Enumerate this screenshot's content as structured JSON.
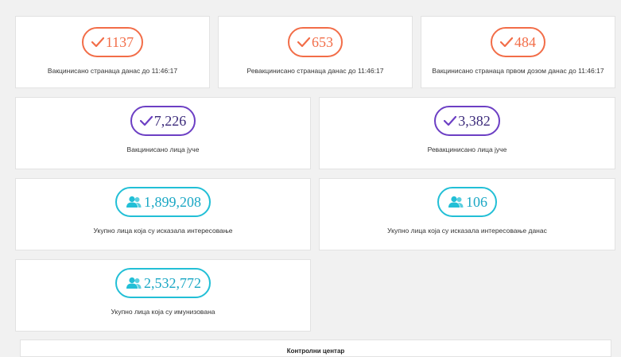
{
  "colors": {
    "orange": "#f26d48",
    "purple": "#6c3fc4",
    "teal": "#22bfd6",
    "background": "#f1f1f1"
  },
  "row1": [
    {
      "icon": "checkmark-icon",
      "value": "1137",
      "label": "Вакцинисано странаца данас до 11:46:17"
    },
    {
      "icon": "checkmark-icon",
      "value": "653",
      "label": "Ревакцинисано странаца данас до 11:46:17"
    },
    {
      "icon": "checkmark-icon",
      "value": "484",
      "label": "Вакцинисано странаца првом дозом данас до 11:46:17"
    }
  ],
  "row2": [
    {
      "icon": "checkmark-icon",
      "value": "7,226",
      "label": "Вакцинисано лица јуче"
    },
    {
      "icon": "checkmark-icon",
      "value": "3,382",
      "label": "Ревакцинисано лица јуче"
    }
  ],
  "row3": [
    {
      "icon": "people-icon",
      "value": "1,899,208",
      "label": "Укупно лица која су исказала интересовање"
    },
    {
      "icon": "people-icon",
      "value": "106",
      "label": "Укупно лица која су исказала интересовање данас"
    }
  ],
  "row4": [
    {
      "icon": "people-icon",
      "value": "2,532,772",
      "label": "Укупно лица која су имунизована"
    }
  ],
  "control_center": {
    "label": "Контролни центар"
  }
}
